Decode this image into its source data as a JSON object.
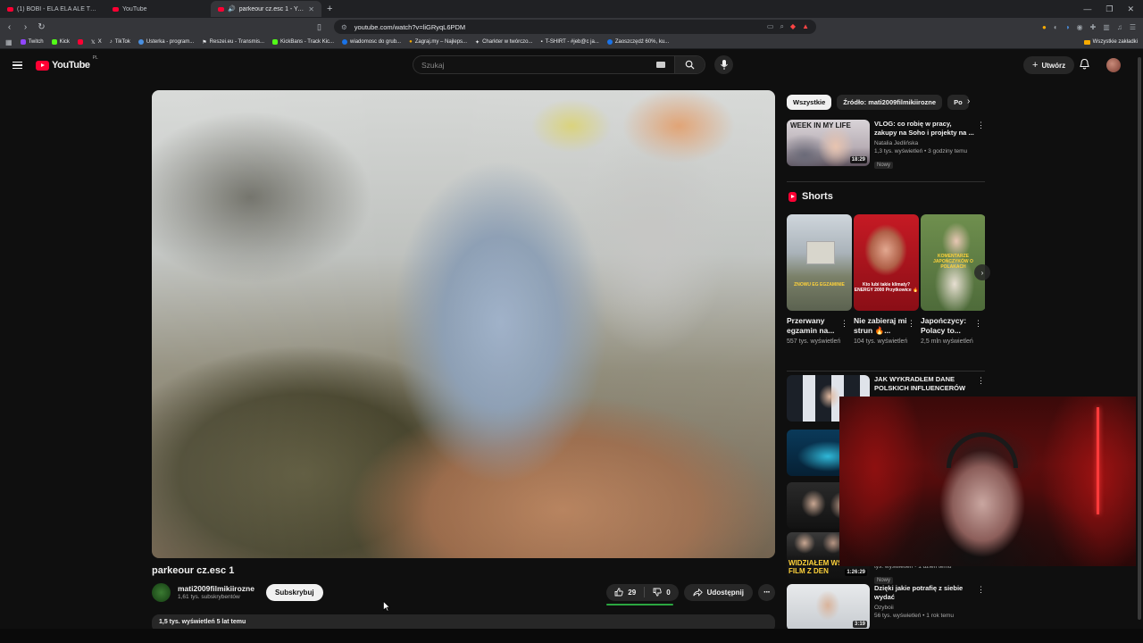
{
  "browser": {
    "tabs": [
      {
        "title": "(1) BOBI - ELA ELA ALE TO MOCNA",
        "active": false
      },
      {
        "title": "YouTube",
        "active": false
      },
      {
        "title": "parkeour cz.esc 1 - YouTube",
        "active": true
      }
    ],
    "new_tab": "+",
    "url": "youtube.com/watch?v=liGRyqL6PDM",
    "bookmarks": [
      {
        "label": "Twitch",
        "color": "#9146ff"
      },
      {
        "label": "Kick",
        "color": "#53fc18"
      },
      {
        "label": "",
        "color": "#ff0033"
      },
      {
        "label": "X",
        "color": "#e8eaed"
      },
      {
        "label": "TikTok",
        "color": "#e8eaed"
      },
      {
        "label": "Usterka - program...",
        "color": "#4a90e2"
      },
      {
        "label": "Reszei.eu - Transmis...",
        "color": "#e8eaed"
      },
      {
        "label": "KickBans - Track Kic...",
        "color": "#53fc18"
      },
      {
        "label": "wiadomosc do grub...",
        "color": "#1a73e8"
      },
      {
        "label": "Zagraj.my – Najleps...",
        "color": "#f9ab00"
      },
      {
        "label": "Charkter w twórczo...",
        "color": "#e8eaed"
      },
      {
        "label": "T-SHIRT - #jeb@c ja...",
        "color": "#e8eaed"
      },
      {
        "label": "Zaoszczędź 60%, ku...",
        "color": "#1a73e8"
      }
    ],
    "bookmarks_folder": "Wszystkie zakładki"
  },
  "masthead": {
    "logo_text": "YouTube",
    "country_code": "PL",
    "search_placeholder": "Szukaj",
    "create_label": "Utwórz"
  },
  "video": {
    "title": "parkeour cz.esc 1",
    "channel_name": "mati2009filmikiirozne",
    "subscribers": "1,61 tys. subskrybentów",
    "subscribe_label": "Subskrybuj",
    "likes": "29",
    "dislikes": "0",
    "share_label": "Udostępnij",
    "description_preview": "1,5 tys. wyświetleń  5 lat temu"
  },
  "sidebar": {
    "chips": [
      {
        "label": "Wszystkie",
        "active": true
      },
      {
        "label": "Źródło: mati2009filmikiirozne",
        "active": false
      },
      {
        "label": "Po",
        "active": false
      }
    ],
    "top_video": {
      "thumb_text": "WEEK IN MY LIFE",
      "title": "VLOG: co robię w pracy, zakupy na Soho i projekty na ...",
      "channel": "Natalia Jedlińska",
      "meta": "1,3 tys. wyświetleń • 3 godziny temu",
      "badge": "Nowy",
      "duration": "18:29"
    },
    "shorts_heading": "Shorts",
    "shorts": [
      {
        "title": "Przerwany egzamin na...",
        "views": "557 tys. wyświetleń",
        "caption": "ZNOWU EG EGZAMINIE"
      },
      {
        "title": "Nie zabieraj mi strun 🔥...",
        "views": "104 tys. wyświetleń",
        "caption": "Kto lubi takie klimaty? ENERGY 2000 Przytkowice 🔥"
      },
      {
        "title": "Japończycy: Polacy to...",
        "views": "2,5 mln wyświetleń",
        "caption": "KOMENTARZE JAPOŃCZYKÓW O POLAKACH"
      }
    ],
    "videos": [
      {
        "title": "JAK WYKRADŁEM DANE POLSKICH INFLUENCERÓW",
        "channel": "",
        "meta": "",
        "badge": "",
        "duration": ""
      },
      {
        "title": "",
        "channel": "",
        "meta": "",
        "badge": "",
        "duration": ""
      },
      {
        "title": "",
        "channel": "",
        "meta": "",
        "badge": "",
        "duration": ""
      },
      {
        "title": "",
        "channel": "",
        "meta": "tys. wyświetleń • 1 dzień temu",
        "badge": "Nowy",
        "duration": "1:26:29",
        "thumb_text": "WIDZIAŁEM WSTYD FILM Z DEN"
      },
      {
        "title": "Dzięki jakie potrafię z siebie wydać",
        "channel": "Ozyboii",
        "meta": "56 tys. wyświetleń • 1 rok temu",
        "badge": "",
        "duration": "3:19"
      }
    ]
  },
  "colors": {
    "background": "#0f0f0f",
    "accent_red": "#ff0033",
    "like_bar": "#2ba640"
  }
}
